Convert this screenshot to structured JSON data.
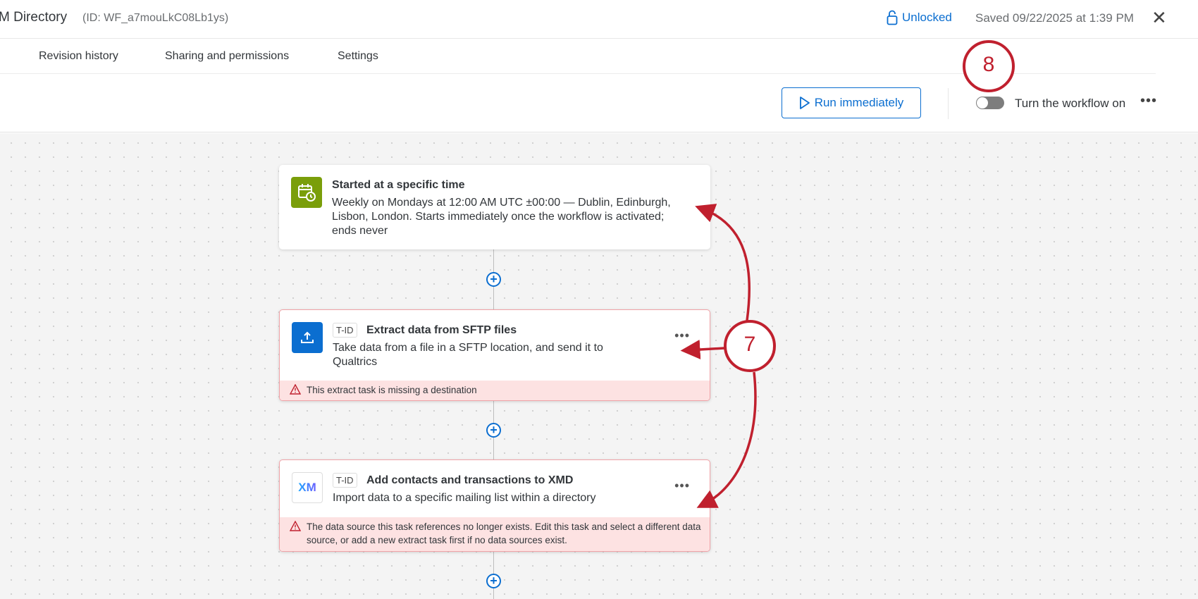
{
  "header": {
    "title": "M Directory",
    "workflow_id": "(ID: WF_a7mouLkC08Lb1ys)",
    "lock_status": "Unlocked",
    "saved": "Saved 09/22/2025 at 1:39 PM"
  },
  "tabs": [
    "Revision history",
    "Sharing and permissions",
    "Settings"
  ],
  "toolbar": {
    "run_label": "Run immediately",
    "toggle_label": "Turn the workflow on",
    "toggle_on": false
  },
  "cards": [
    {
      "title": "Started at a specific time",
      "body": "Weekly on Mondays at 12:00 AM UTC ±00:00 — Dublin, Edinburgh, Lisbon, London. Starts immediately once the workflow is activated; ends never",
      "icon": "calendar-clock-icon",
      "icon_color": "#7a9e0a"
    },
    {
      "badge": "T-ID",
      "title": "Extract data from SFTP files",
      "body": "Take data from a file in a SFTP location, and send it to Qualtrics",
      "warning": "This extract task is missing a destination",
      "icon": "upload-icon",
      "icon_color": "#0b6ed0"
    },
    {
      "badge": "T-ID",
      "title": "Add contacts and transactions to XMD",
      "body": "Import data to a specific mailing list within a directory",
      "warning": "The data source this task references no longer exists. Edit this task and select a different data source, or add a new extract task first if no data sources exist.",
      "icon": "xm-logo-icon",
      "icon_text": "XM"
    }
  ],
  "annotations": {
    "callout_7": "7",
    "callout_8": "8",
    "color": "#c0202e"
  },
  "colors": {
    "accent": "#0b6ed0",
    "error_bg": "#fde2e2",
    "error_border": "#f0a3a8"
  }
}
